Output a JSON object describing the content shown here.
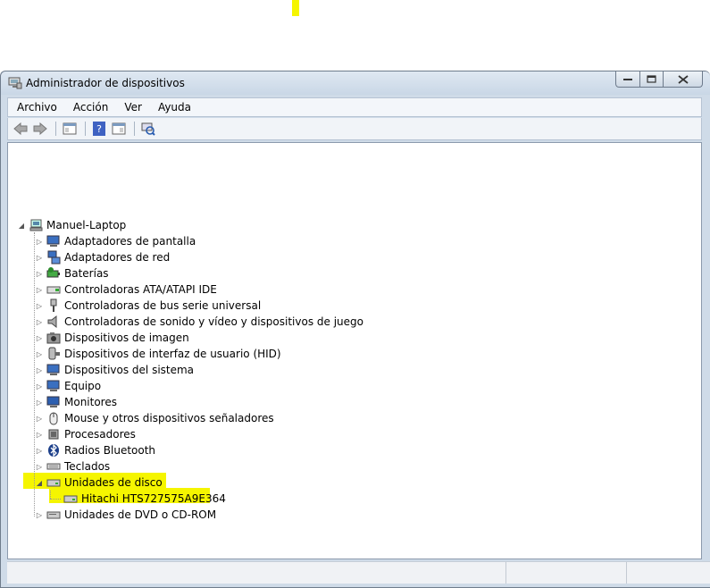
{
  "window": {
    "title": "Administrador de dispositivos"
  },
  "menu": {
    "items": [
      "Archivo",
      "Acción",
      "Ver",
      "Ayuda"
    ]
  },
  "tree": {
    "root": "Manuel-Laptop",
    "categories": [
      {
        "label": "Adaptadores de pantalla",
        "icon": "display-adapter-icon"
      },
      {
        "label": "Adaptadores de red",
        "icon": "network-adapter-icon"
      },
      {
        "label": "Baterías",
        "icon": "battery-icon"
      },
      {
        "label": "Controladoras ATA/ATAPI IDE",
        "icon": "ide-controller-icon"
      },
      {
        "label": "Controladoras de bus serie universal",
        "icon": "usb-icon"
      },
      {
        "label": "Controladoras de sonido y vídeo y dispositivos de juego",
        "icon": "speaker-icon"
      },
      {
        "label": "Dispositivos de imagen",
        "icon": "camera-icon"
      },
      {
        "label": "Dispositivos de interfaz de usuario (HID)",
        "icon": "hid-icon"
      },
      {
        "label": "Dispositivos del sistema",
        "icon": "system-device-icon"
      },
      {
        "label": "Equipo",
        "icon": "computer-icon"
      },
      {
        "label": "Monitores",
        "icon": "monitor-icon"
      },
      {
        "label": "Mouse y otros dispositivos señaladores",
        "icon": "mouse-icon"
      },
      {
        "label": "Procesadores",
        "icon": "processor-icon"
      },
      {
        "label": "Radios Bluetooth",
        "icon": "bluetooth-icon"
      },
      {
        "label": "Teclados",
        "icon": "keyboard-icon"
      },
      {
        "label": "Unidades de disco",
        "icon": "disk-drive-icon",
        "expanded": true
      },
      {
        "label": "Unidades de DVD o CD-ROM",
        "icon": "dvd-drive-icon"
      }
    ],
    "disk_child": "Hitachi HTS727575A9E364"
  },
  "colors": {
    "highlight": "#f5f500",
    "frame": "#cfdbe8"
  }
}
